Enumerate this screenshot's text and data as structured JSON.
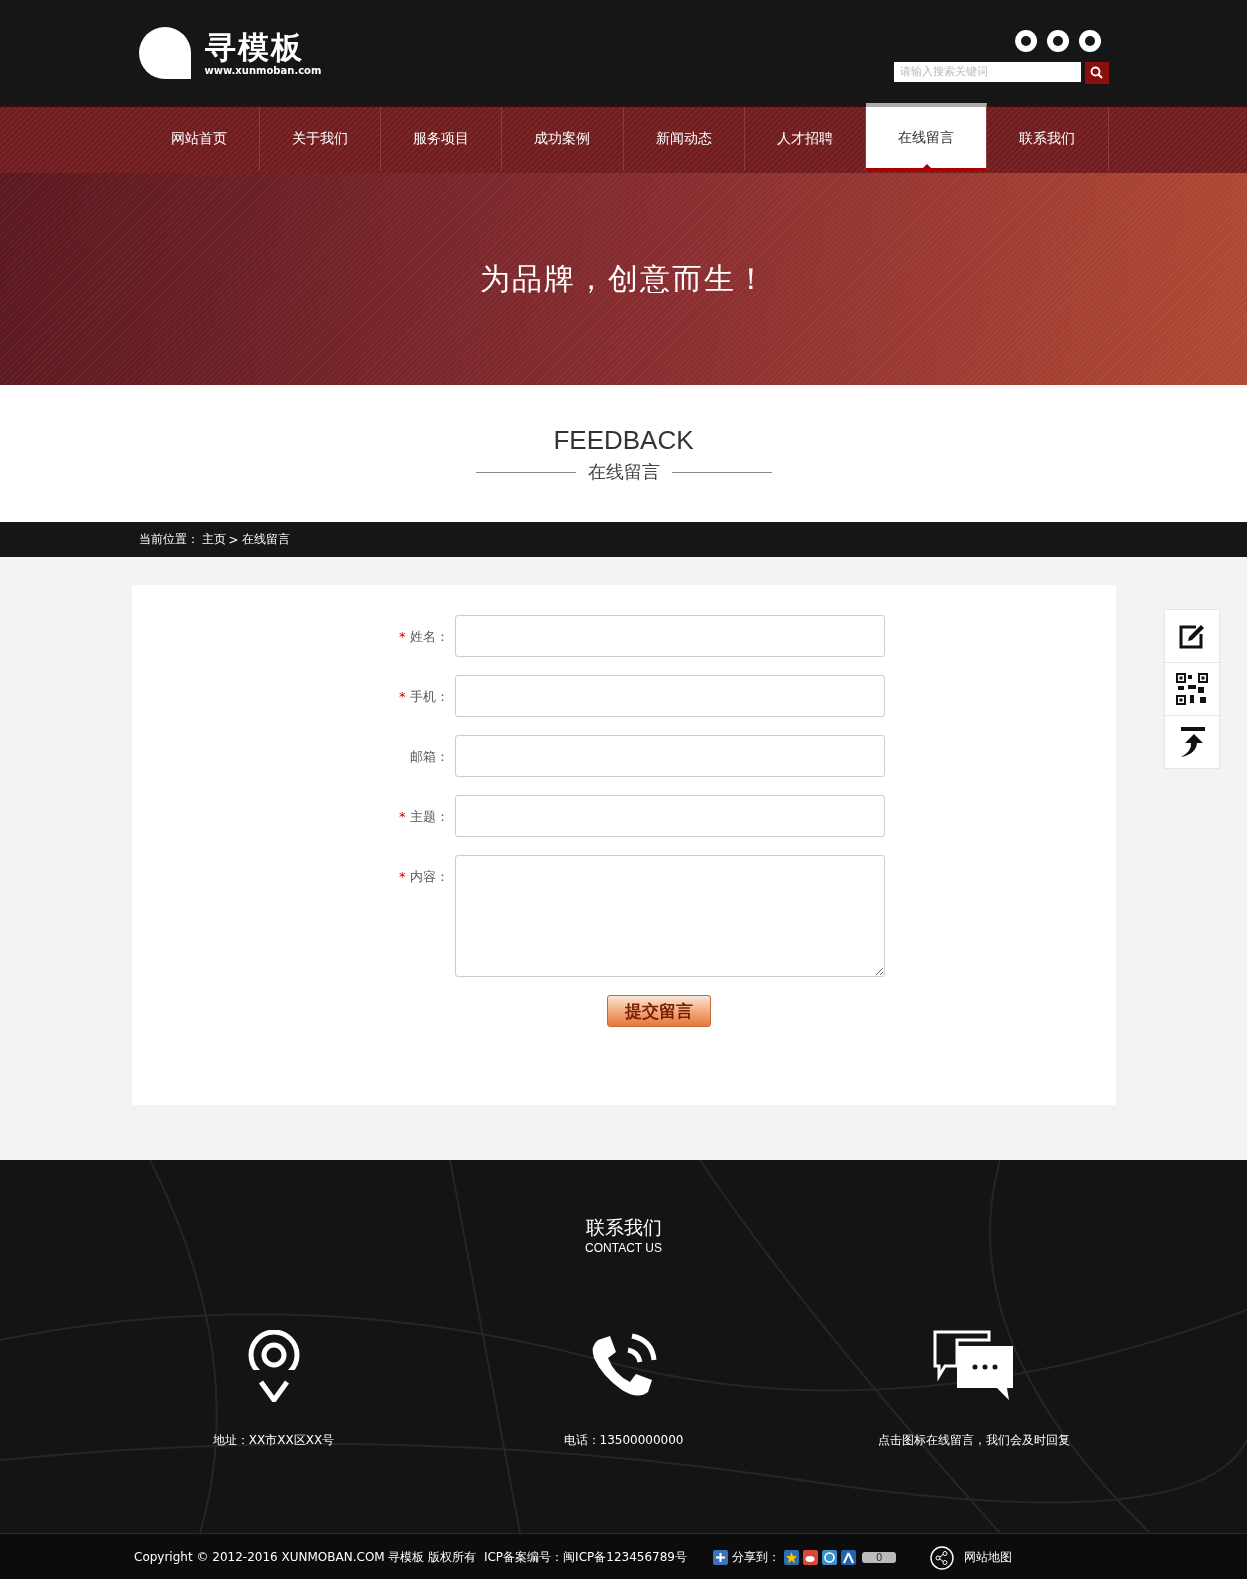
{
  "header": {
    "logo": {
      "name": "寻模板",
      "url": "www.xunmoban.com"
    },
    "search": {
      "placeholder": "请输入搜索关键词"
    }
  },
  "nav": [
    {
      "label": "网站首页",
      "selected": false
    },
    {
      "label": "关于我们",
      "selected": false
    },
    {
      "label": "服务项目",
      "selected": false
    },
    {
      "label": "成功案例",
      "selected": false
    },
    {
      "label": "新闻动态",
      "selected": false
    },
    {
      "label": "人才招聘",
      "selected": false
    },
    {
      "label": "在线留言",
      "selected": true
    },
    {
      "label": "联系我们",
      "selected": false
    }
  ],
  "banner": {
    "slogan": "为品牌，创意而生！"
  },
  "section": {
    "title": "FEEDBACK",
    "subtitle": "在线留言"
  },
  "breadcrumb": {
    "label": "当前位置：",
    "items": [
      "主页",
      "在线留言"
    ],
    "separator": ">"
  },
  "form": {
    "fields": [
      {
        "label": "姓名：",
        "required": true,
        "kind": "input"
      },
      {
        "label": "手机：",
        "required": true,
        "kind": "input"
      },
      {
        "label": "邮箱：",
        "required": false,
        "kind": "input"
      },
      {
        "label": "主题：",
        "required": true,
        "kind": "input"
      },
      {
        "label": "内容：",
        "required": true,
        "kind": "textarea"
      }
    ],
    "required_mark": "*",
    "submit": "提交留言"
  },
  "footer": {
    "title": "联系我们",
    "subtitle": "CONTACT US",
    "items": [
      {
        "kind": "address",
        "text": "地址：XX市XX区XX号"
      },
      {
        "kind": "phone",
        "text": "电话：13500000000"
      },
      {
        "kind": "message",
        "text": "点击图标在线留言，我们会及时回复"
      }
    ]
  },
  "bottom_bar": {
    "copyright": "Copyright © 2012-2016 XUNMOBAN.COM 寻模板 版权所有  ICP备案编号：闽ICP备123456789号",
    "share_label": "分享到：",
    "share_count": "0",
    "sitemap": "网站地图"
  }
}
